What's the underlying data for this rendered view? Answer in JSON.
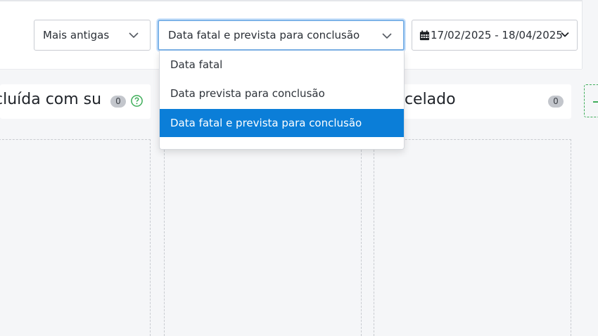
{
  "filters": {
    "sort": {
      "value": "Mais antigas",
      "icon": "chevron-down-icon"
    },
    "date_type": {
      "value": "Data fatal e prevista para conclusão",
      "icon": "chevron-down-icon",
      "options": [
        "Data fatal",
        "Data prevista para conclusão",
        "Data fatal e prevista para conclusão"
      ],
      "selected_index": 2
    },
    "date_range": {
      "value": "17/02/2025 - 18/04/2025",
      "icon": "calendar-icon"
    }
  },
  "columns": [
    {
      "title": "cluída com su",
      "count": "0",
      "help_icon": "help-circle-icon"
    },
    {
      "title": "ncelado",
      "count": "0"
    }
  ],
  "colors": {
    "accent": "#0b7ed8",
    "focus_border": "#7db3e8",
    "success": "#3fae5a",
    "badge": "#c3c6cc"
  }
}
